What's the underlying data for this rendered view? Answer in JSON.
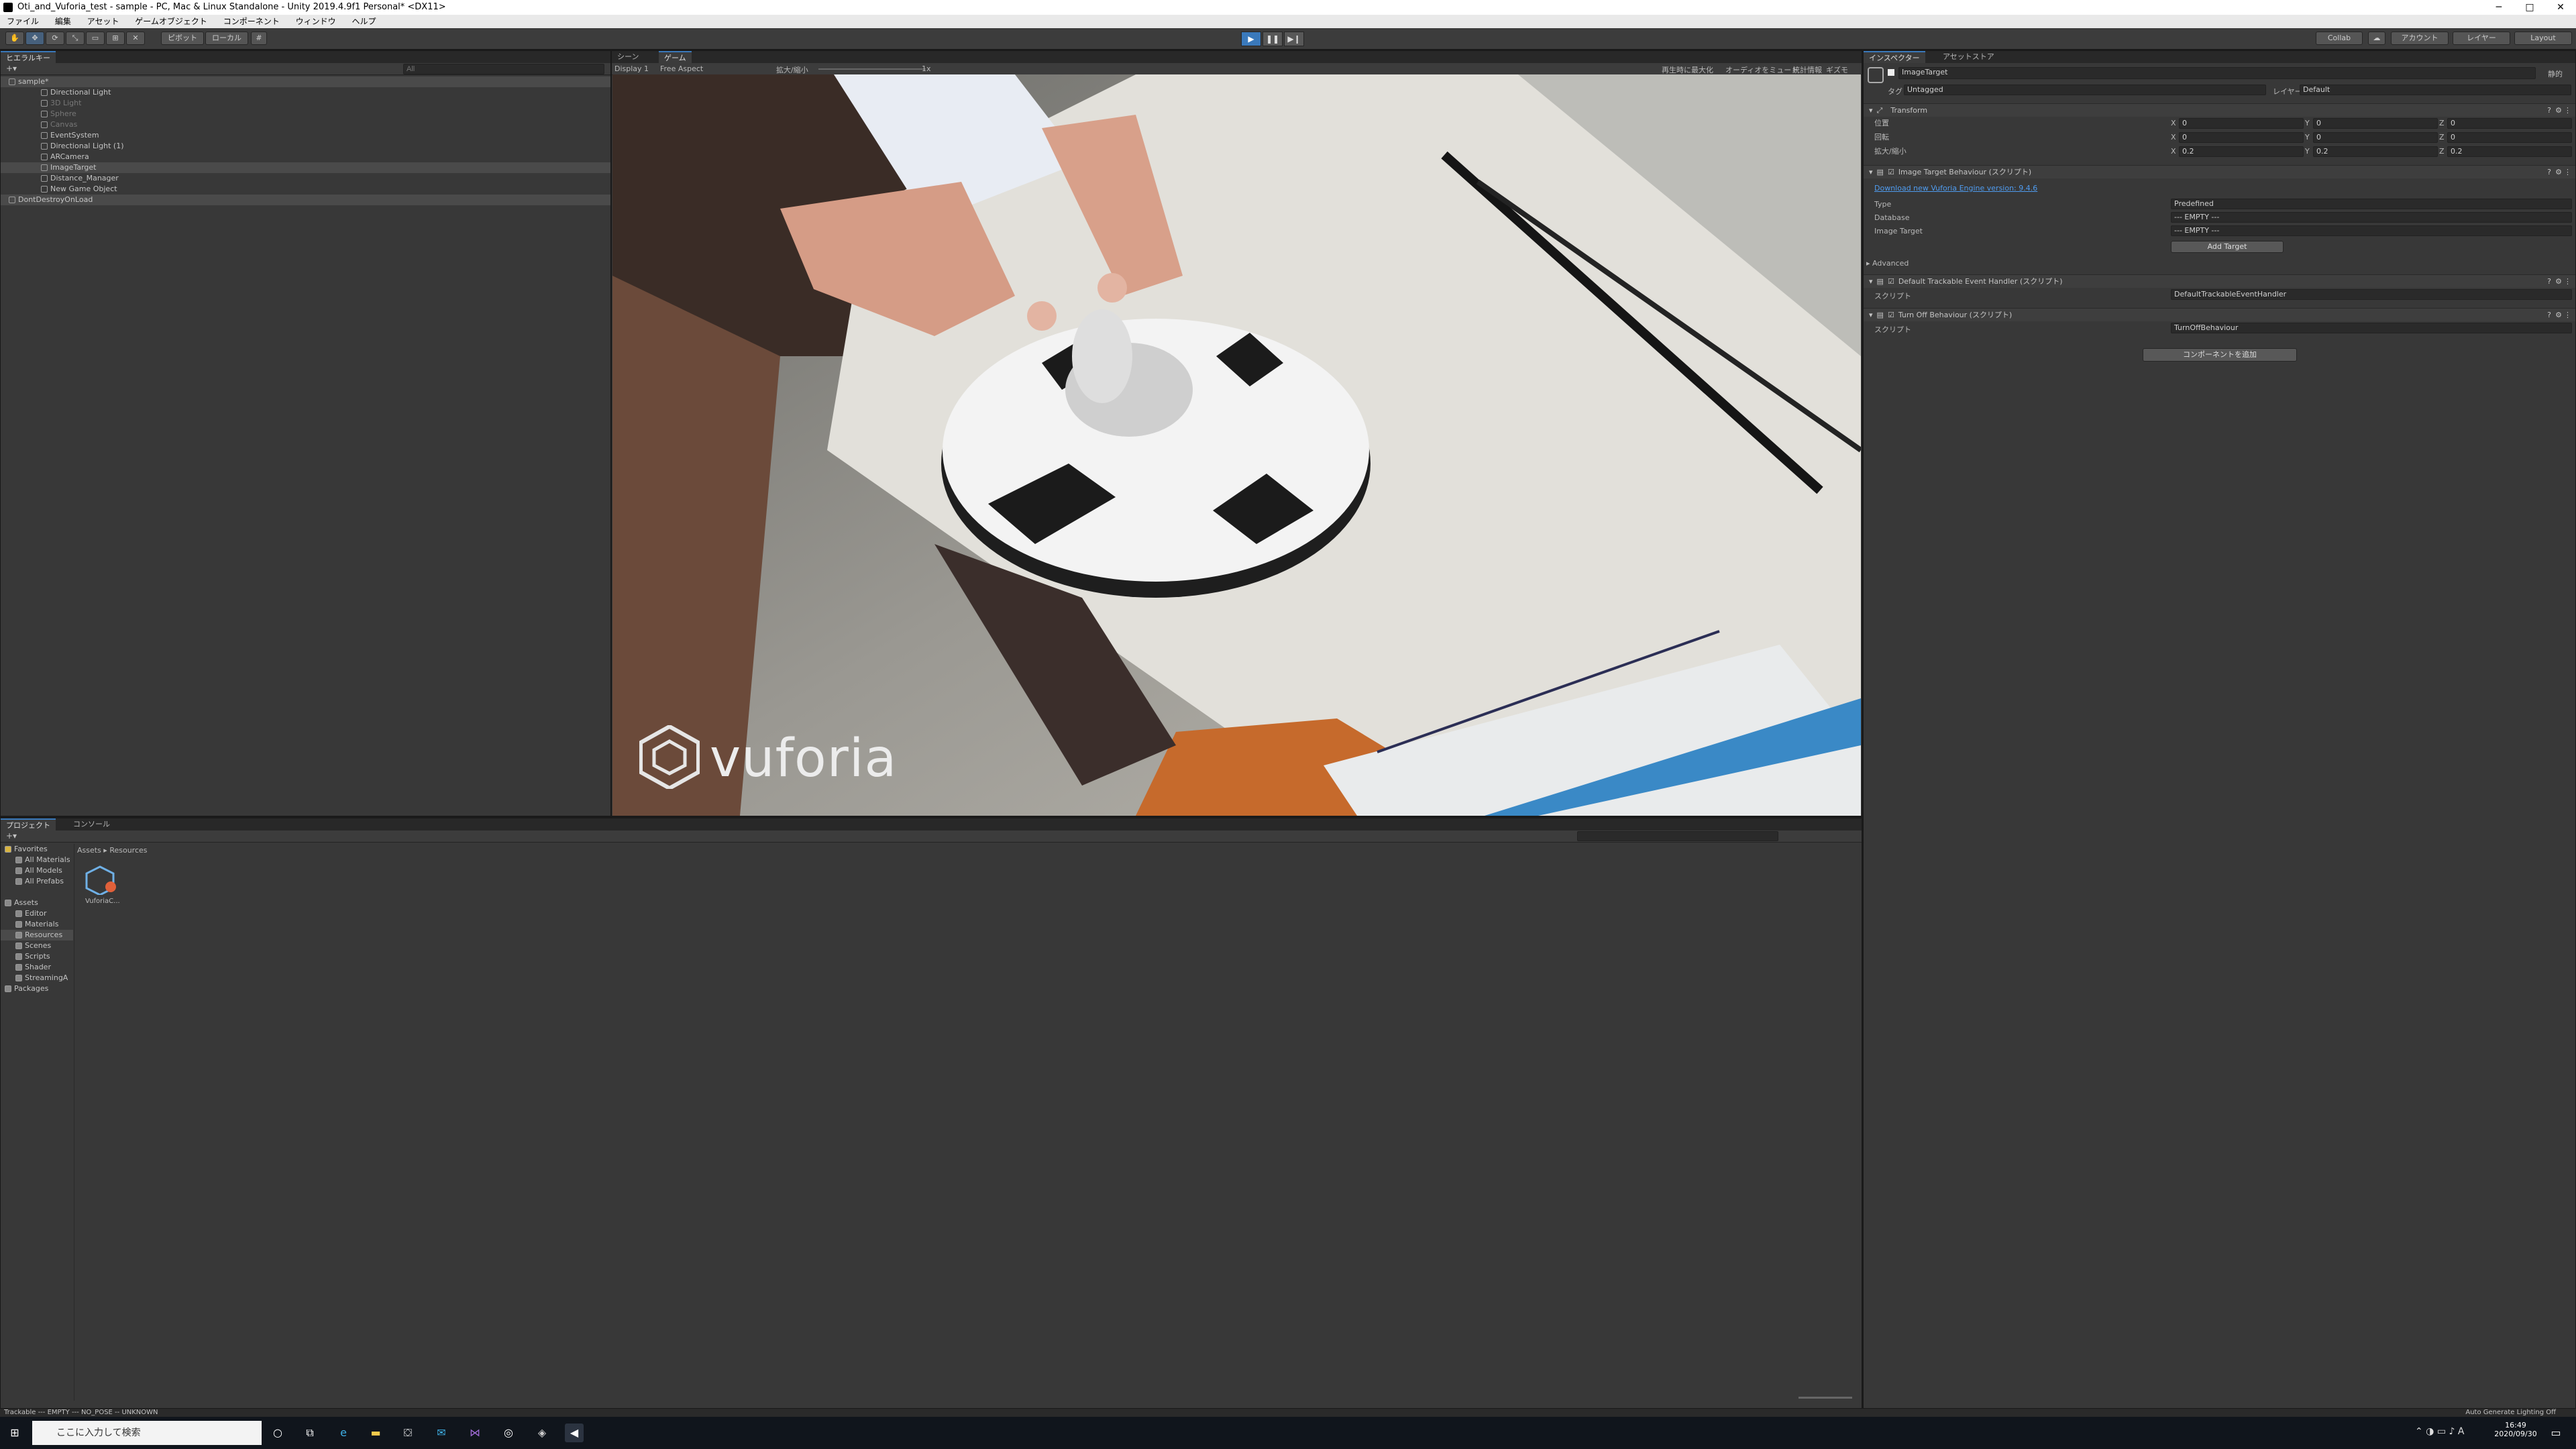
{
  "window": {
    "title": "Oti_and_Vuforia_test - sample - PC, Mac & Linux Standalone - Unity 2019.4.9f1 Personal* <DX11>",
    "minimize": "─",
    "maximize": "□",
    "close": "✕"
  },
  "menu": [
    "ファイル",
    "編集",
    "アセット",
    "ゲームオブジェクト",
    "コンポーネント",
    "ウィンドウ",
    "ヘルプ"
  ],
  "toolbar": {
    "pivot": "ピボット",
    "local": "ローカル",
    "collab": "Collab",
    "account": "アカウント",
    "layers": "レイヤー",
    "layout": "Layout"
  },
  "hierarchy": {
    "tab": "ヒエラルキー",
    "search_placeholder": "All",
    "items": [
      {
        "label": "sample*",
        "depth": 0,
        "state": "scene"
      },
      {
        "label": "Directional Light",
        "depth": 1,
        "state": "normal"
      },
      {
        "label": "3D Light",
        "depth": 1,
        "state": "dim"
      },
      {
        "label": "Sphere",
        "depth": 1,
        "state": "dim"
      },
      {
        "label": "Canvas",
        "depth": 1,
        "state": "dim"
      },
      {
        "label": "EventSystem",
        "depth": 1,
        "state": "normal"
      },
      {
        "label": "Directional Light (1)",
        "depth": 1,
        "state": "normal"
      },
      {
        "label": "ARCamera",
        "depth": 1,
        "state": "normal"
      },
      {
        "label": "ImageTarget",
        "depth": 1,
        "state": "selected"
      },
      {
        "label": "Distance_Manager",
        "depth": 1,
        "state": "normal"
      },
      {
        "label": "New Game Object",
        "depth": 1,
        "state": "normal"
      },
      {
        "label": "DontDestroyOnLoad",
        "depth": 0,
        "state": "scene"
      }
    ]
  },
  "game": {
    "tabs": [
      "シーン",
      "ゲーム"
    ],
    "display": "Display 1",
    "aspect": "Free Aspect",
    "scale_label": "拡大/縮小",
    "scale_value": "1x",
    "options": [
      "再生時に最大化",
      "オーディオをミュート",
      "統計情報",
      "ギズモ"
    ],
    "watermark": "vuforia"
  },
  "inspector": {
    "tabs": [
      "インスペクター",
      "アセットストア"
    ],
    "object_name": "ImageTarget",
    "static": "静的",
    "tag_label": "タグ",
    "tag": "Untagged",
    "layer_label": "レイヤー",
    "layer": "Default",
    "transform": {
      "title": "Transform",
      "rows": [
        {
          "label": "位置",
          "x": "0",
          "y": "0",
          "z": "0"
        },
        {
          "label": "回転",
          "x": "0",
          "y": "0",
          "z": "0"
        },
        {
          "label": "拡大/縮小",
          "x": "0.2",
          "y": "0.2",
          "z": "0.2"
        }
      ]
    },
    "itb": {
      "title": "Image Target Behaviour (スクリプト)",
      "link": "Download new Vuforia Engine version: 9.4.6",
      "type_label": "Type",
      "type": "Predefined",
      "database_label": "Database",
      "database": "--- EMPTY ---",
      "image_target_label": "Image Target",
      "image_target": "--- EMPTY ---",
      "add_target": "Add Target",
      "advanced": "Advanced"
    },
    "dteh": {
      "title": "Default Trackable Event Handler (スクリプト)",
      "script_label": "スクリプト",
      "script": "DefaultTrackableEventHandler"
    },
    "tob": {
      "title": "Turn Off Behaviour (スクリプト)",
      "script_label": "スクリプト",
      "script": "TurnOffBehaviour"
    },
    "add_component": "コンポーネントを追加"
  },
  "project": {
    "tabs": [
      "プロジェクト",
      "コンソール"
    ],
    "breadcrumb": [
      "Assets",
      "Resources"
    ],
    "tree": [
      {
        "label": "Favorites",
        "depth": 0
      },
      {
        "label": "All Materials",
        "depth": 1
      },
      {
        "label": "All Models",
        "depth": 1
      },
      {
        "label": "All Prefabs",
        "depth": 1
      },
      {
        "label": "Assets",
        "depth": 0
      },
      {
        "label": "Editor",
        "depth": 1
      },
      {
        "label": "Materials",
        "depth": 1
      },
      {
        "label": "Resources",
        "depth": 1
      },
      {
        "label": "Scenes",
        "depth": 1
      },
      {
        "label": "Scripts",
        "depth": 1
      },
      {
        "label": "Shader",
        "depth": 1
      },
      {
        "label": "StreamingA",
        "depth": 1
      },
      {
        "label": "Packages",
        "depth": 0
      }
    ],
    "asset_label": "VuforiaC..."
  },
  "status": {
    "left": "Trackable --- EMPTY --- NO_POSE -- UNKNOWN",
    "right": "Auto Generate Lighting Off"
  },
  "taskbar": {
    "search_placeholder": "ここに入力して検索",
    "time": "16:49",
    "date": "2020/09/30"
  },
  "colors": {
    "accent": "#3a79bb",
    "panel": "#383838",
    "selection": "#2c5d87"
  }
}
